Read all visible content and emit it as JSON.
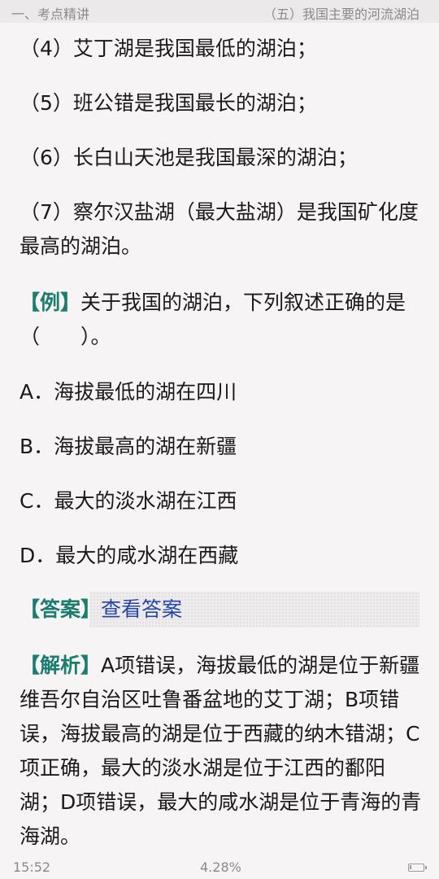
{
  "header": {
    "chapter": "一、考点精讲",
    "section": "（五）我国主要的河流湖泊"
  },
  "content": {
    "item4": "（4）艾丁湖是我国最低的湖泊；",
    "item5": "（5）班公错是我国最长的湖泊；",
    "item6": "（6）长白山天池是我国最深的湖泊；",
    "item7": "（7）察尔汉盐湖（最大盐湖）是我国矿化度最高的湖泊。",
    "example_tag": "【例】",
    "example_question": "关于我国的湖泊，下列叙述正确的是（　　）。",
    "option_a": "A．海拔最低的湖在四川",
    "option_b": "B．海拔最高的湖在新疆",
    "option_c": "C．最大的淡水湖在江西",
    "option_d": "D．最大的咸水湖在西藏",
    "answer_tag": "【答案】",
    "answer_link": "查看答案",
    "analysis_tag": "【解析】",
    "analysis_text": "A项错误，海拔最低的湖是位于新疆维吾尔自治区吐鲁番盆地的艾丁湖；B项错误，海拔最高的湖是位于西藏的纳木错湖；C项正确，最大的淡水湖是位于江西的鄱阳湖；D项错误，最大的咸水湖是位于青海的青海湖。"
  },
  "footer": {
    "time": "15:52",
    "progress": "4.28%",
    "battery_level": 0.15
  },
  "colors": {
    "tag": "#1a7d6e",
    "link": "#2546a8",
    "background": "#f7f4f5"
  }
}
